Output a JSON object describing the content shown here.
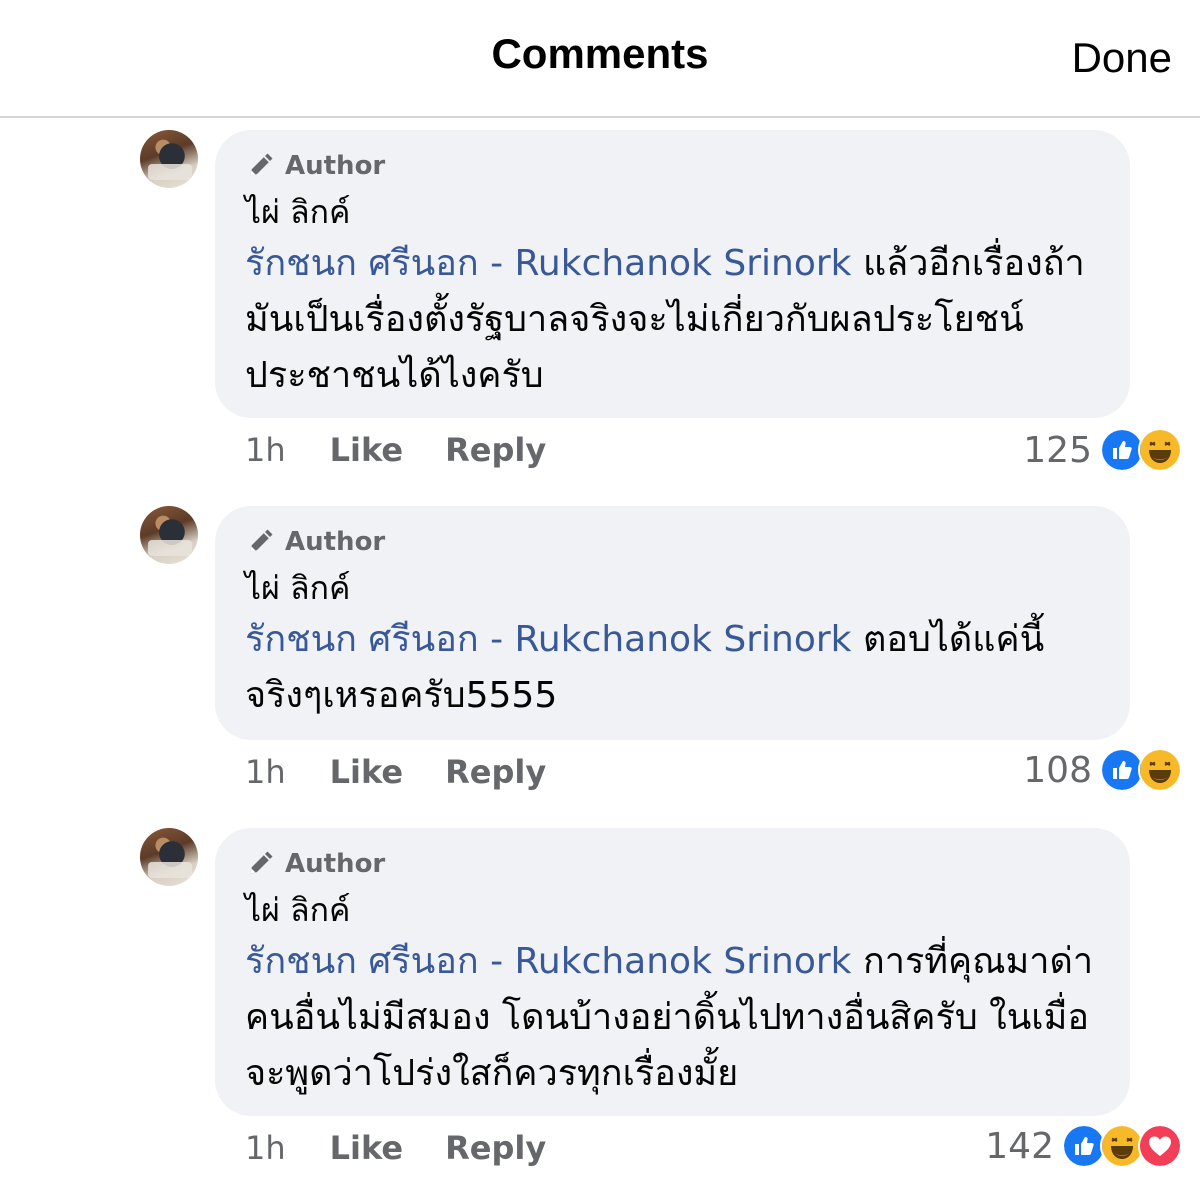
{
  "header": {
    "title": "Comments",
    "done_label": "Done"
  },
  "comments": [
    {
      "badge": "Author",
      "name": "ไผ่ ลิกค์",
      "mention": "รักชนก ศรีนอก - Rukchanok Srinork",
      "text": " แล้วอีกเรื่องถ้ามันเป็นเรื่องตั้งรัฐบาลจริงจะไม่เกี่ยวกับผลประโยชน์ประชาชนได้ไงครับ",
      "time": "1h",
      "like_label": "Like",
      "reply_label": "Reply",
      "reaction_count": "125",
      "reactions": [
        "like-icon",
        "haha-icon"
      ]
    },
    {
      "badge": "Author",
      "name": "ไผ่ ลิกค์",
      "mention": "รักชนก ศรีนอก - Rukchanok Srinork",
      "text": " ตอบได้แค่นี้จริงๆเหรอครับ5555",
      "time": "1h",
      "like_label": "Like",
      "reply_label": "Reply",
      "reaction_count": "108",
      "reactions": [
        "like-icon",
        "haha-icon"
      ]
    },
    {
      "badge": "Author",
      "name": "ไผ่ ลิกค์",
      "mention": "รักชนก ศรีนอก - Rukchanok Srinork",
      "text": " การที่คุณมาด่าคนอื่นไม่มีสมอง โดนบ้างอย่าดิ้นไปทางอื่นสิครับ ในเมื่อจะพูดว่าโปร่งใสก็ควรทุกเรื่องมั้ย",
      "time": "1h",
      "like_label": "Like",
      "reply_label": "Reply",
      "reaction_count": "142",
      "reactions": [
        "like-icon",
        "haha-icon",
        "love-icon"
      ]
    }
  ],
  "colors": {
    "mention": "#385898",
    "bubble": "#f0f2f5",
    "meta": "#65676b",
    "like": "#1877f2",
    "haha": "#f7b928",
    "love": "#f33e58"
  }
}
